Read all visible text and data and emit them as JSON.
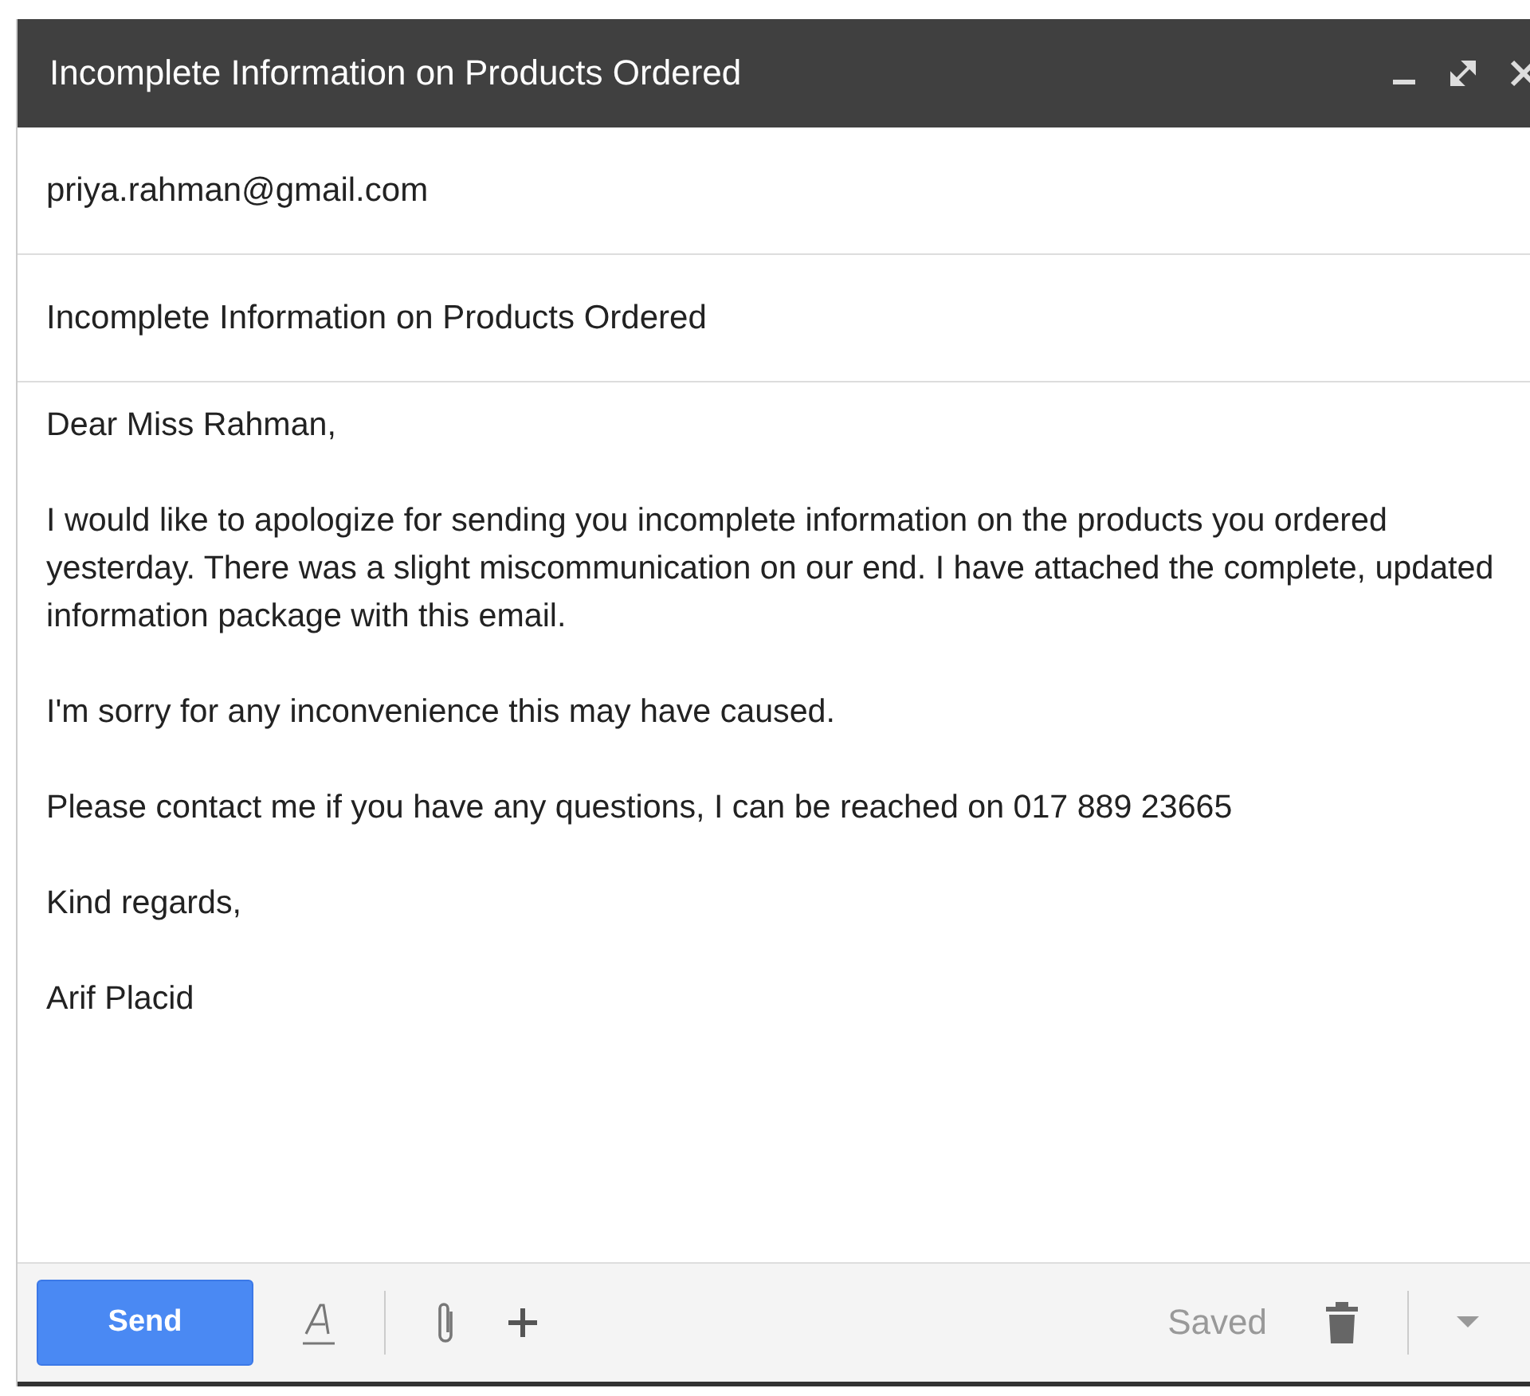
{
  "window": {
    "title": "Incomplete Information on Products Ordered"
  },
  "to": {
    "value": "priya.rahman@gmail.com"
  },
  "subject": {
    "value": "Incomplete Information on Products Ordered"
  },
  "body": [
    "Dear Miss Rahman,",
    "I would like to apologize for sending you incomplete information on the products you ordered yesterday. There was a slight miscommunication on our end. I have attached the complete, updated information package with this email.",
    "I'm sorry for any inconvenience this may have caused.",
    "Please contact me if you have any questions, I can be reached on 017 889 23665",
    "Kind regards,",
    "Arif Placid"
  ],
  "toolbar": {
    "send": "Send",
    "status": "Saved"
  }
}
